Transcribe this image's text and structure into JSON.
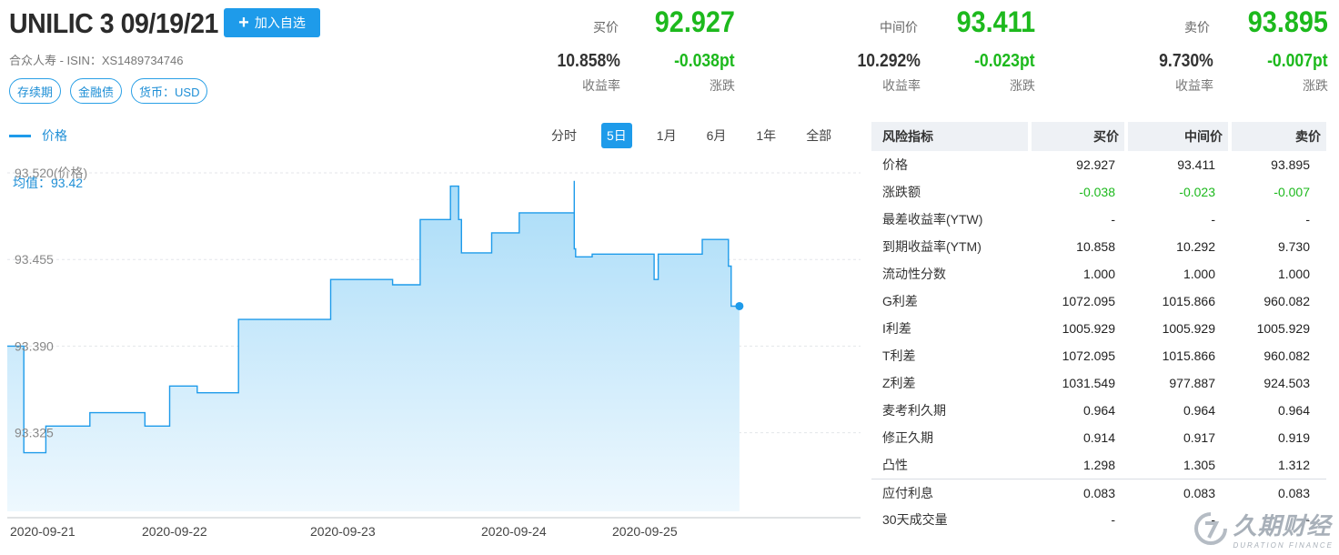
{
  "bond": {
    "title": "UNILIC 3 09/19/21",
    "add_label": "加入自选",
    "subinfo": "合众人寿 - ISIN：XS1489734746",
    "tags": [
      "存续期",
      "金融债",
      "货币：USD"
    ]
  },
  "quotes": {
    "bid": {
      "label": "买价",
      "price": "92.927",
      "yield": "10.858%",
      "change": "-0.038pt",
      "yield_label": "收益率",
      "change_label": "涨跌"
    },
    "mid": {
      "label": "中间价",
      "price": "93.411",
      "yield": "10.292%",
      "change": "-0.023pt",
      "yield_label": "收益率",
      "change_label": "涨跌"
    },
    "ask": {
      "label": "卖价",
      "price": "93.895",
      "yield": "9.730%",
      "change": "-0.007pt",
      "yield_label": "收益率",
      "change_label": "涨跌"
    }
  },
  "chart_panel": {
    "legend": "价格",
    "avg_label": "均值：93.42",
    "range_tabs": [
      "分时",
      "5日",
      "1月",
      "6月",
      "1年",
      "全部"
    ],
    "active_tab": "5日"
  },
  "chart_data": {
    "type": "area",
    "title": "",
    "series": [
      {
        "name": "价格",
        "x": [
          0,
          0.12,
          0.12,
          0.28,
          0.28,
          0.6,
          0.6,
          1.0,
          1.0,
          1.18,
          1.18,
          1.38,
          1.38,
          1.68,
          1.68,
          2.35,
          2.35,
          2.8,
          2.8,
          3.0,
          3.0,
          3.22,
          3.22,
          3.28,
          3.28,
          3.3,
          3.3,
          3.52,
          3.52,
          3.72,
          3.72,
          4.12,
          4.12,
          4.12,
          4.13,
          4.13,
          4.25,
          4.25,
          4.4,
          4.4,
          4.7,
          4.7,
          4.73,
          4.73,
          5.05,
          5.05,
          5.24,
          5.24,
          5.26,
          5.26,
          5.32
        ],
        "values": [
          93.39,
          93.39,
          93.31,
          93.31,
          93.33,
          93.33,
          93.34,
          93.34,
          93.33,
          93.33,
          93.36,
          93.36,
          93.355,
          93.355,
          93.41,
          93.41,
          93.44,
          93.44,
          93.436,
          93.436,
          93.485,
          93.485,
          93.51,
          93.51,
          93.485,
          93.485,
          93.46,
          93.46,
          93.475,
          93.475,
          93.49,
          93.49,
          93.514,
          93.463,
          93.463,
          93.457,
          93.457,
          93.459,
          93.459,
          93.459,
          93.459,
          93.44,
          93.44,
          93.459,
          93.459,
          93.47,
          93.47,
          93.45,
          93.45,
          93.42,
          93.42
        ]
      }
    ],
    "y_tick_labels": [
      "93.520(价格)",
      "93.455",
      "93.390",
      "93.325"
    ],
    "ylim": [
      93.266,
      93.52
    ],
    "x_tick_labels": [
      "2020-09-21",
      "2020-09-22",
      "2020-09-23",
      "2020-09-24",
      "2020-09-25"
    ],
    "grid": true,
    "colors": {
      "line": "#1e9bea",
      "fill_top": "#a9dcf8",
      "fill_bottom": "#eef8fe"
    }
  },
  "risk_table": {
    "headers": [
      "风险指标",
      "买价",
      "中间价",
      "卖价"
    ],
    "rows": [
      {
        "name": "价格",
        "bid": "92.927",
        "mid": "93.411",
        "ask": "93.895"
      },
      {
        "name": "涨跌额",
        "bid": "-0.038",
        "mid": "-0.023",
        "ask": "-0.007"
      },
      {
        "name": "最差收益率(YTW)",
        "bid": "-",
        "mid": "-",
        "ask": "-"
      },
      {
        "name": "到期收益率(YTM)",
        "bid": "10.858",
        "mid": "10.292",
        "ask": "9.730"
      },
      {
        "name": "流动性分数",
        "bid": "1.000",
        "mid": "1.000",
        "ask": "1.000"
      },
      {
        "name": "G利差",
        "bid": "1072.095",
        "mid": "1015.866",
        "ask": "960.082"
      },
      {
        "name": "I利差",
        "bid": "1005.929",
        "mid": "1005.929",
        "ask": "1005.929"
      },
      {
        "name": "T利差",
        "bid": "1072.095",
        "mid": "1015.866",
        "ask": "960.082"
      },
      {
        "name": "Z利差",
        "bid": "1031.549",
        "mid": "977.887",
        "ask": "924.503"
      },
      {
        "name": "麦考利久期",
        "bid": "0.964",
        "mid": "0.964",
        "ask": "0.964"
      },
      {
        "name": "修正久期",
        "bid": "0.914",
        "mid": "0.917",
        "ask": "0.919"
      },
      {
        "name": "凸性",
        "bid": "1.298",
        "mid": "1.305",
        "ask": "1.312"
      },
      {
        "name": "应付利息",
        "bid": "0.083",
        "mid": "0.083",
        "ask": "0.083"
      },
      {
        "name": "30天成交量",
        "bid": "-",
        "mid": "-",
        "ask": "-"
      }
    ]
  },
  "watermark": {
    "cn": "久期财经",
    "en": "DURATION FINANCE"
  },
  "colors": {
    "accent": "#1e9bea",
    "down": "#1db91d"
  }
}
